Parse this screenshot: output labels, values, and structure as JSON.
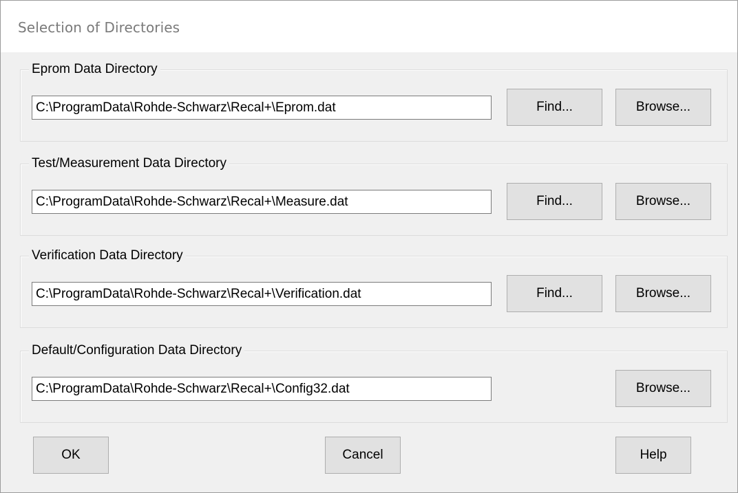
{
  "window": {
    "title": "Selection of Directories"
  },
  "groups": [
    {
      "legend": "Eprom Data Directory",
      "path": "C:\\ProgramData\\Rohde-Schwarz\\Recal+\\Eprom.dat",
      "find_label": "Find...",
      "browse_label": "Browse..."
    },
    {
      "legend": "Test/Measurement Data Directory",
      "path": "C:\\ProgramData\\Rohde-Schwarz\\Recal+\\Measure.dat",
      "find_label": "Find...",
      "browse_label": "Browse..."
    },
    {
      "legend": "Verification Data Directory",
      "path": "C:\\ProgramData\\Rohde-Schwarz\\Recal+\\Verification.dat",
      "find_label": "Find...",
      "browse_label": "Browse..."
    },
    {
      "legend": "Default/Configuration Data Directory",
      "path": "C:\\ProgramData\\Rohde-Schwarz\\Recal+\\Config32.dat",
      "browse_label": "Browse..."
    }
  ],
  "footer": {
    "ok_label": "OK",
    "cancel_label": "Cancel",
    "help_label": "Help"
  }
}
